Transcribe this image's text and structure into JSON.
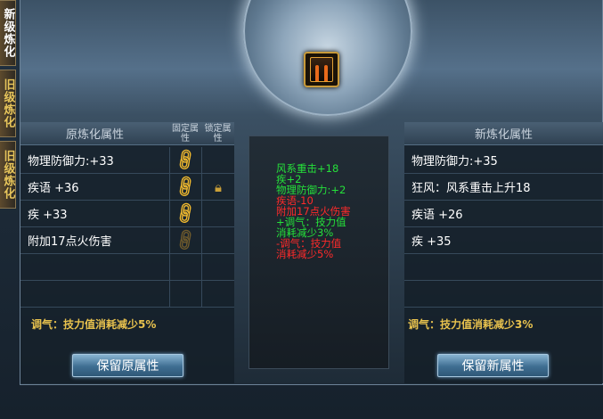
{
  "tabs": [
    {
      "label": "新级炼化",
      "state": "active"
    },
    {
      "label": "旧级炼化",
      "state": "inactive"
    },
    {
      "label": "旧级炼化",
      "state": "inactive"
    }
  ],
  "left": {
    "header": "原炼化属性",
    "fixed_header": "固定属性",
    "lock_header": "锁定属性",
    "rows": [
      "物理防御力:+33",
      "疾语 +36",
      "疾 +33",
      "附加17点火伤害"
    ],
    "tiaoqi": "调气：技力值消耗减少5%",
    "button": "保留原属性"
  },
  "right": {
    "header": "新炼化属性",
    "rows": [
      "物理防御力:+35",
      "狂风：风系重击上升18",
      "疾语 +26",
      "疾 +35"
    ],
    "tiaoqi": "调气：技力值消耗减少3%",
    "button": "保留新属性"
  },
  "center": {
    "lines": [
      {
        "text": "风系重击+18",
        "color": "green"
      },
      {
        "text": "疾+2",
        "color": "green"
      },
      {
        "text": "物理防御力:+2",
        "color": "green"
      },
      {
        "text": "疾语-10",
        "color": "red"
      },
      {
        "text": "附加17点火伤害",
        "color": "red"
      },
      {
        "text": "+调气：技力值",
        "color": "green"
      },
      {
        "text": "消耗减少3%",
        "color": "green"
      },
      {
        "text": "-调气：技力值",
        "color": "red"
      },
      {
        "text": "消耗减少5%",
        "color": "red"
      }
    ]
  }
}
